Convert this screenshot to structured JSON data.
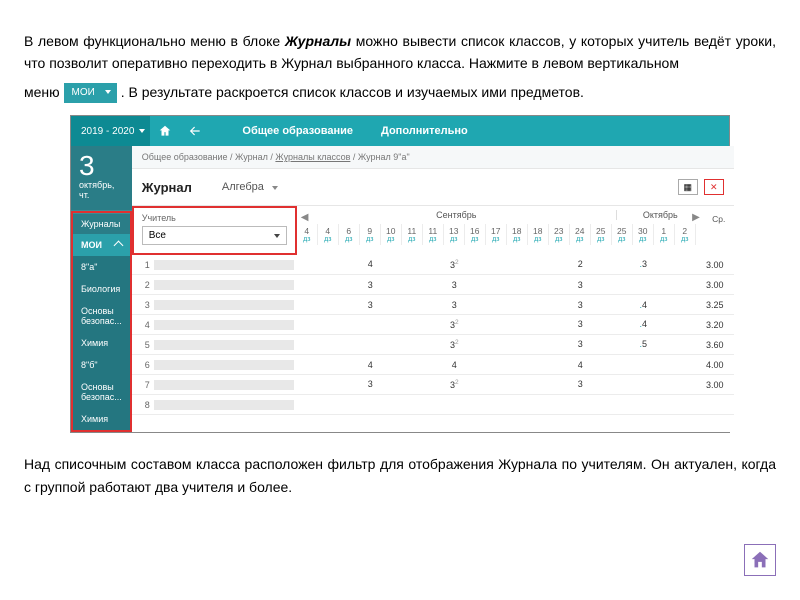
{
  "paragraph1": {
    "before": "В левом функционально меню в блоке",
    "bold": " Журналы ",
    "after": "можно вывести список классов, у которых учитель ведёт уроки, что позволит оперативно переходить в Журнал выбранного класса. Нажмите в левом вертикальном"
  },
  "paragraph2": {
    "menu_prefix": "меню ",
    "button_label": "МОИ",
    "after": ". В результате раскроется список классов и изучаемых ими предметов."
  },
  "footer_paragraph": "Над списочным составом класса расположен фильтр для отображения Журнала по учителям. Он актуален, когда с группой работают два учителя и более.",
  "topbar": {
    "year": "2019 - 2020",
    "nav": [
      "Общее образование",
      "Дополнительно"
    ]
  },
  "sidebar": {
    "date_num": "3",
    "date_day": "октябрь, чт.",
    "items": [
      "Журналы",
      "МОИ",
      "8\"а\"",
      "Биология",
      "Основы безопас...",
      "Химия",
      "8\"б\"",
      "Основы безопас...",
      "Химия"
    ]
  },
  "breadcrumb": [
    "Общее образование",
    "Журнал",
    "Журналы классов",
    "Журнал 9\"а\""
  ],
  "title_row": {
    "title": "Журнал",
    "subject": "Алгебра"
  },
  "teacher_filter": {
    "label": "Учитель",
    "value": "Все"
  },
  "calendar": {
    "months": [
      "Сентябрь",
      "Октябрь"
    ],
    "avg_label": "Ср.",
    "days": [
      {
        "n": "4",
        "s": "дз"
      },
      {
        "n": "4",
        "s": "дз"
      },
      {
        "n": "6",
        "s": "дз"
      },
      {
        "n": "9",
        "s": "дз"
      },
      {
        "n": "10",
        "s": "дз"
      },
      {
        "n": "11",
        "s": "дз"
      },
      {
        "n": "11",
        "s": "дз"
      },
      {
        "n": "13",
        "s": "дз"
      },
      {
        "n": "16",
        "s": "дз"
      },
      {
        "n": "17",
        "s": "дз"
      },
      {
        "n": "18",
        "s": "дз"
      },
      {
        "n": "18",
        "s": "дз"
      },
      {
        "n": "23",
        "s": "дз"
      },
      {
        "n": "24",
        "s": "дз"
      },
      {
        "n": "25",
        "s": "дз"
      },
      {
        "n": "25",
        "s": "дз"
      },
      {
        "n": "30",
        "s": "дз"
      },
      {
        "n": "1",
        "s": "дз"
      },
      {
        "n": "2",
        "s": "дз"
      }
    ]
  },
  "rows": [
    {
      "n": 1,
      "grades": {
        "3": "4",
        "7": "3",
        "7s": "2",
        "13": "2",
        "16": "3",
        "16p": "."
      },
      "avg": "3.00"
    },
    {
      "n": 2,
      "grades": {
        "3": "3",
        "7": "3",
        "13": "3"
      },
      "avg": "3.00"
    },
    {
      "n": 3,
      "grades": {
        "3": "3",
        "7": "3",
        "13": "3",
        "16": "4",
        "16p": "."
      },
      "avg": "3.25"
    },
    {
      "n": 4,
      "grades": {
        "7": "3",
        "7s": "2",
        "13": "3",
        "16": "4",
        "16p": "."
      },
      "avg": "3.20"
    },
    {
      "n": 5,
      "grades": {
        "7": "3",
        "7s": "2",
        "13": "3",
        "16": "5",
        "16p": "."
      },
      "avg": "3.60"
    },
    {
      "n": 6,
      "grades": {
        "3": "4",
        "7": "4",
        "13": "4"
      },
      "avg": "4.00"
    },
    {
      "n": 7,
      "grades": {
        "3": "3",
        "7": "3",
        "7s": "2",
        "13": "3"
      },
      "avg": "3.00"
    },
    {
      "n": 8,
      "grades": {},
      "avg": ""
    }
  ]
}
